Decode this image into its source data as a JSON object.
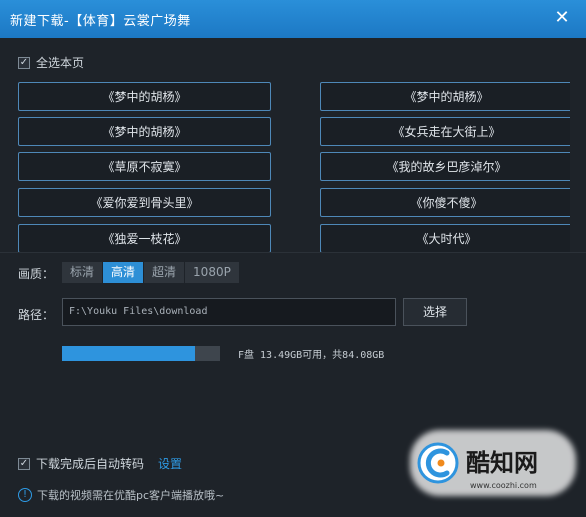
{
  "window": {
    "title": "新建下载-【体育】云裳广场舞",
    "close_icon": "close-icon"
  },
  "select_all": {
    "label": "全选本页",
    "checked": true
  },
  "songs": [
    "《梦中的胡杨》",
    "《梦中的胡杨》",
    "《梦中的胡杨》",
    "《女兵走在大街上》",
    "《草原不寂寞》",
    "《我的故乡巴彦淖尔》",
    "《爱你爱到骨头里》",
    "《你傻不傻》",
    "《独爱一枝花》",
    "《大时代》"
  ],
  "quality": {
    "label": "画质：",
    "options": [
      "标清",
      "高清",
      "超清",
      "1080P"
    ],
    "selected": "高清"
  },
  "path": {
    "label": "路径：",
    "value": "F:\\Youku Files\\download",
    "choose_label": "选择"
  },
  "disk": {
    "used_fraction": 0.84,
    "info": "F盘 13.49GB可用，共84.08GB"
  },
  "auto_transcode": {
    "label": "下载完成后自动转码",
    "checked": true,
    "settings_label": "设置"
  },
  "notice": "下载的视频需在优酷pc客户端播放哦~",
  "watermark": {
    "brand": "酷知网",
    "url": "www.coozhi.com"
  },
  "colors": {
    "accent": "#2e94de",
    "title_bar": "#1c78c4",
    "background": "#1e2329"
  }
}
